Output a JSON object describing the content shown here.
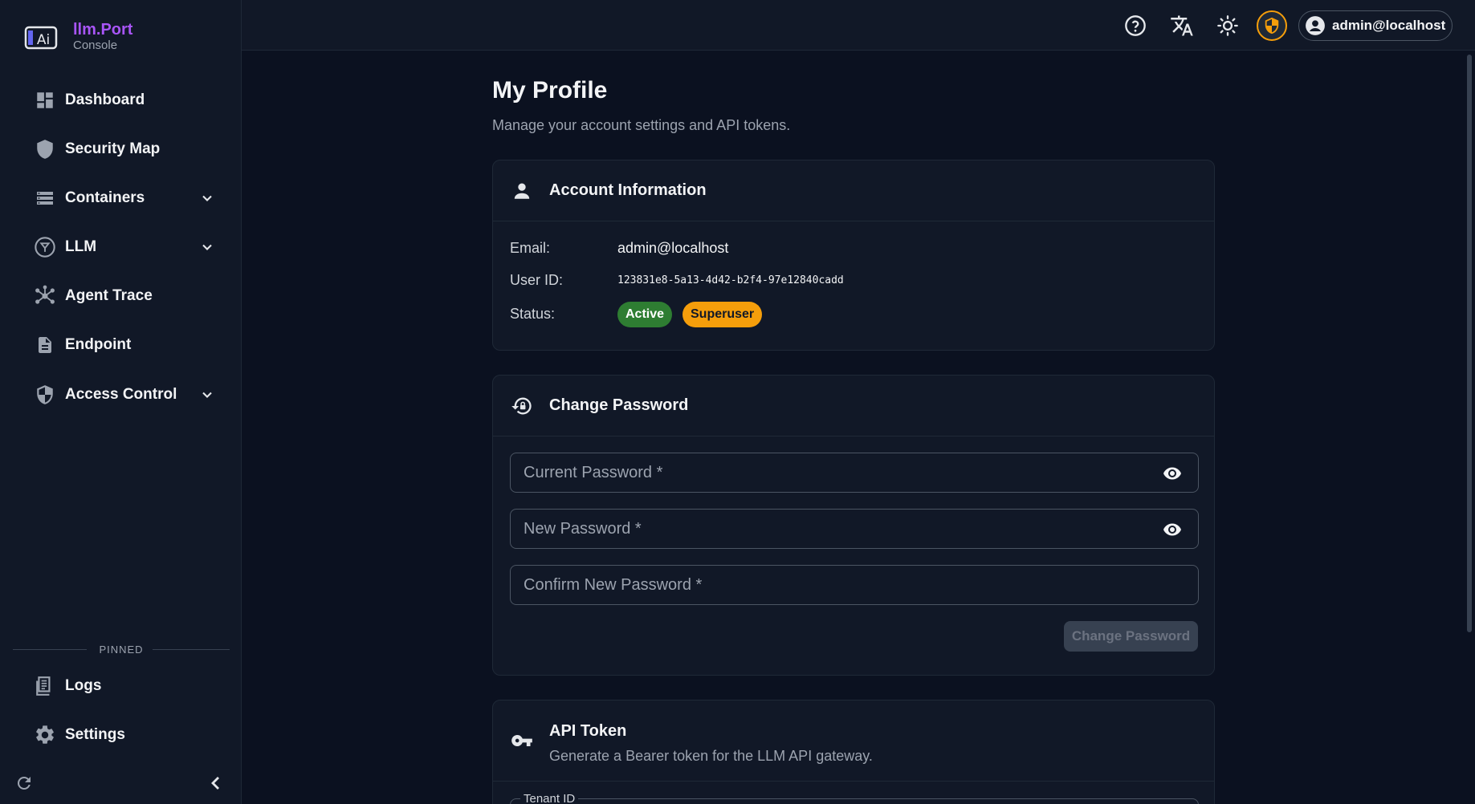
{
  "brand": {
    "name": "llm.Port",
    "subtitle": "Console"
  },
  "sidebar": {
    "items": [
      {
        "label": "Dashboard",
        "icon": "dashboard-icon"
      },
      {
        "label": "Security Map",
        "icon": "shield-icon"
      },
      {
        "label": "Containers",
        "icon": "containers-icon",
        "expandable": true
      },
      {
        "label": "LLM",
        "icon": "llm-icon",
        "expandable": true
      },
      {
        "label": "Agent Trace",
        "icon": "trace-icon"
      },
      {
        "label": "Endpoint",
        "icon": "document-icon"
      },
      {
        "label": "Access Control",
        "icon": "shield-lock-icon",
        "expandable": true
      }
    ],
    "pinned_heading": "PINNED",
    "pinned": [
      {
        "label": "Logs",
        "icon": "logs-icon"
      },
      {
        "label": "Settings",
        "icon": "gear-icon"
      }
    ]
  },
  "topbar": {
    "icons": [
      "help-icon",
      "translate-icon",
      "theme-icon",
      "shield-badge-icon"
    ],
    "user_label": "admin@localhost"
  },
  "page": {
    "title": "My Profile",
    "subtitle": "Manage your account settings and API tokens."
  },
  "account": {
    "title": "Account Information",
    "email_label": "Email:",
    "email_value": "admin@localhost",
    "userid_label": "User ID:",
    "userid_value": "123831e8-5a13-4d42-b2f4-97e12840cadd",
    "status_label": "Status:",
    "badges": [
      {
        "label": "Active",
        "color": "#2e7d32"
      },
      {
        "label": "Superuser",
        "color": "#f59e0b"
      }
    ]
  },
  "password": {
    "title": "Change Password",
    "current_placeholder": "Current Password *",
    "new_placeholder": "New Password *",
    "confirm_placeholder": "Confirm New Password *",
    "button_label": "Change Password"
  },
  "api_token": {
    "title": "API Token",
    "subtitle": "Generate a Bearer token for the LLM API gateway.",
    "tenant_label": "Tenant ID"
  },
  "colors": {
    "accent": "#a855f7",
    "background": "#0b1120",
    "panel": "#111827"
  }
}
